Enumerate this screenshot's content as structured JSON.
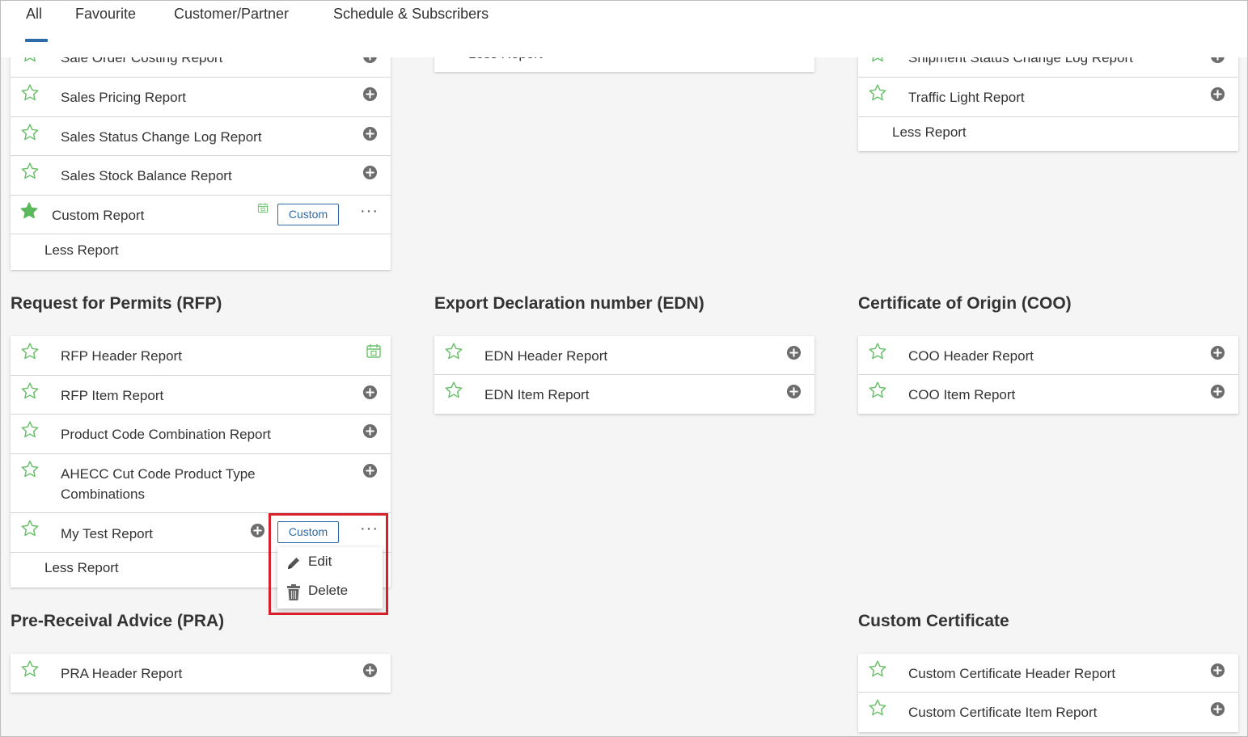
{
  "tabs": [
    {
      "label": "All",
      "active": true
    },
    {
      "label": "Favourite"
    },
    {
      "label": "Customer/Partner"
    },
    {
      "label": "Schedule & Subscribers"
    }
  ],
  "top_left": {
    "partial": "Sale Order Costing Report",
    "items": [
      "Sales Pricing Report",
      "Sales Status Change Log Report",
      "Sales Stock Balance Report"
    ],
    "custom_item": "Custom Report",
    "badge": "Custom",
    "less": "Less Report"
  },
  "top_middle": {
    "partial": "Less Report"
  },
  "top_right": {
    "partial": "Shipment Status Change Log Report",
    "items": [
      "Traffic Light Report"
    ],
    "less": "Less Report"
  },
  "rfp": {
    "title": "Request for Permits (RFP)",
    "items": [
      "RFP Header Report",
      "RFP Item Report",
      "Product Code Combination Report"
    ],
    "multiline_item": [
      "AHECC Cut Code Product Type",
      "Combinations"
    ],
    "custom_item": "My Test Report",
    "badge": "Custom",
    "less": "Less Report"
  },
  "context_menu": {
    "edit": "Edit",
    "delete": "Delete"
  },
  "edn": {
    "title": "Export Declaration number (EDN)",
    "items": [
      "EDN Header Report",
      "EDN Item Report"
    ]
  },
  "coo": {
    "title": "Certificate of Origin (COO)",
    "items": [
      "COO Header Report",
      "COO Item Report"
    ]
  },
  "pra": {
    "title": "Pre-Receival Advice (PRA)",
    "items": [
      "PRA Header Report"
    ]
  },
  "custom_cert": {
    "title": "Custom Certificate",
    "items": [
      "Custom Certificate Header Report",
      "Custom Certificate Item Report"
    ]
  },
  "colors": {
    "star_outline": "#6cc06c",
    "star_filled": "#5cb85c",
    "accent": "#2c6aa8",
    "highlight": "#d6212b",
    "add_icon": "#6d6d6d"
  }
}
